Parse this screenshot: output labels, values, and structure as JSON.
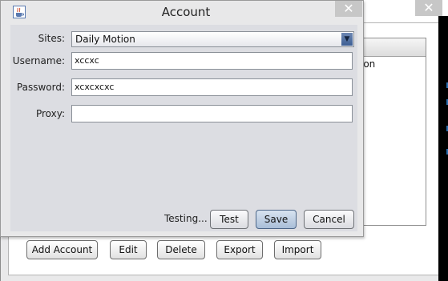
{
  "background_window": {
    "table_cell_partial": "ion",
    "close_glyph": "✕",
    "buttons": {
      "add_account": "Add Account",
      "edit": "Edit",
      "delete": "Delete",
      "export": "Export",
      "import": "Import"
    }
  },
  "dialog": {
    "title": "Account",
    "close_glyph": "✕",
    "icon": "java-coffee-cup-icon",
    "fields": {
      "sites_label": "Sites:",
      "sites_value": "Daily Motion",
      "username_label": "Username:",
      "username_value": "xccxc",
      "password_label": "Password:",
      "password_value": "xcxcxcxc",
      "proxy_label": "Proxy:",
      "proxy_value": ""
    },
    "status": "Testing...",
    "buttons": {
      "test": "Test",
      "save": "Save",
      "cancel": "Cancel"
    }
  },
  "colors": {
    "dialog_body": "#dcdde2",
    "focused_button": "#a9bed8",
    "combo_arrow": "#3e5f94"
  }
}
